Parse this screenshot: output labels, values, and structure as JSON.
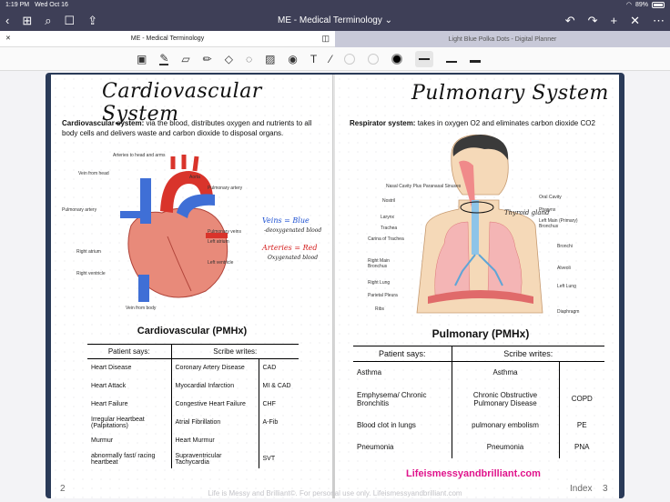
{
  "status": {
    "time": "1:19 PM",
    "date": "Wed Oct 16",
    "battery": "89%"
  },
  "nav": {
    "title": "ME - Medical Terminology ⌄"
  },
  "tabs": {
    "active": "ME - Medical Terminology",
    "inactive": "Light Blue Polka Dots - Digital Planner"
  },
  "left": {
    "title": "Cardiovascular System",
    "def_bold": "Cardiovascular system:",
    "def_text": " via the blood, distributes oxygen and nutrients to all body cells and delivers waste and carbon dioxide to disposal organs.",
    "labels": {
      "arteries": "Arteries to head and arms",
      "vein_head": "Vein from head",
      "aorta": "Aorta",
      "pulm_artery_r": "Pulmonary artery",
      "pulm_artery_l": "Pulmonary artery",
      "pulm_veins": "Pulmonary veins",
      "left_atrium": "Left atrium",
      "right_atrium": "Right atrium",
      "left_ventricle": "Left ventricle",
      "right_ventricle": "Right ventricle",
      "vein_body": "Vein from body"
    },
    "notes": {
      "veins_blue": "Veins = Blue",
      "deoxy": "-deoxygenated blood",
      "arteries_red": "Arteries = Red",
      "oxy": "Oxygenated blood"
    },
    "table_title": "Cardiovascular (PMHx)",
    "headers": {
      "patient": "Patient says:",
      "scribe": "Scribe writes:"
    },
    "rows": [
      {
        "patient": "Heart Disease",
        "scribe": "Coronary Artery Disease",
        "abbr": "CAD"
      },
      {
        "patient": "Heart Attack",
        "scribe": "Myocardial Infarction",
        "abbr": "MI & CAD"
      },
      {
        "patient": "Heart Failure",
        "scribe": "Congestive Heart Failure",
        "abbr": "CHF"
      },
      {
        "patient": "Irregular Heartbeat (Palpitations)",
        "scribe": "Atrial Fibrillation",
        "abbr": "A-Fib"
      },
      {
        "patient": "Murmur",
        "scribe": "Heart Murmur",
        "abbr": ""
      },
      {
        "patient": "abnormally fast/ racing heartbeat",
        "scribe": "Supraventricular Tachycardia",
        "abbr": "SVT"
      }
    ],
    "page_num": "2"
  },
  "right": {
    "title": "Pulmonary System",
    "def_bold": "Respirator system:",
    "def_text": " takes in oxygen O2 and eliminates carbon dioxide CO2",
    "labels": {
      "nasal": "Nasal Cavity Plus Paranasal Sinuses",
      "nostril": "Nostril",
      "oral": "Oral Cavity",
      "pharynx": "Pharynx",
      "larynx": "Larynx",
      "trachea": "Trachea",
      "carina": "Carina of Trachea",
      "left_main": "Left Main (Primary) Bronchus",
      "bronchi": "Bronchi",
      "right_main": "Right Main Bronchus",
      "alveoli": "Alveoli",
      "right_lung": "Right Lung",
      "left_lung": "Left Lung",
      "pleura": "Parietal Pleura",
      "ribs": "Ribs",
      "diaphragm": "Diaphragm"
    },
    "thyroid_note": "Thyroid gland",
    "table_title": "Pulmonary (PMHx)",
    "headers": {
      "patient": "Patient says:",
      "scribe": "Scribe writes:"
    },
    "rows": [
      {
        "patient": "Asthma",
        "scribe": "Asthma",
        "abbr": ""
      },
      {
        "patient": "Emphysema/ Chronic Bronchitis",
        "scribe": "Chronic Obstructive Pulmonary Disease",
        "abbr": "COPD"
      },
      {
        "patient": "Blood clot in lungs",
        "scribe": "pulmonary embolism",
        "abbr": "PE"
      },
      {
        "patient": "Pneumonia",
        "scribe": "Pneumonia",
        "abbr": "PNA"
      }
    ],
    "index_label": "Index",
    "page_num": "3"
  },
  "footer": "Life is Messy and Brilliant©. For personal use only. Lifeismessyandbrilliant.com",
  "watermark": "Lifeismessyandbrilliant.com"
}
